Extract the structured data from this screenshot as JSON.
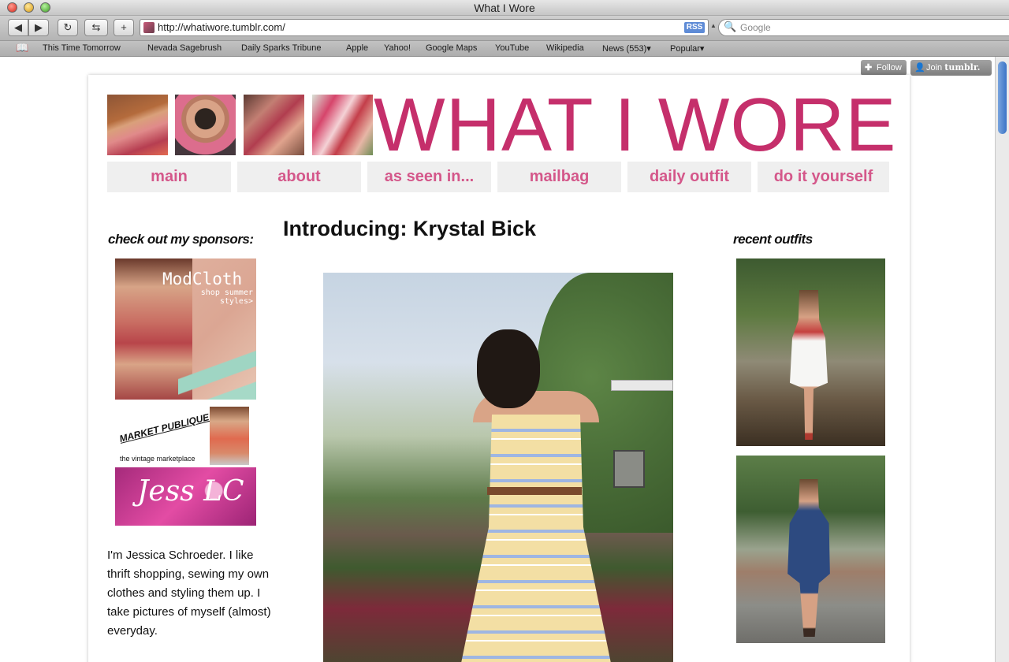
{
  "browser": {
    "window_title": "What I Wore",
    "url": "http://whatiwore.tumblr.com/",
    "rss_label": "RSS",
    "search_placeholder": "Google",
    "bookmarks": [
      "This Time Tomorrow",
      "Nevada Sagebrush",
      "Daily Sparks Tribune",
      "Apple",
      "Yahoo!",
      "Google Maps",
      "YouTube",
      "Wikipedia",
      "News (553)",
      "Popular"
    ]
  },
  "tumblr": {
    "follow_label": "Follow",
    "join_prefix": "Join",
    "join_brand": "tumblr."
  },
  "site": {
    "logo": "WHAT I WORE",
    "accent_color": "#c52f6b",
    "nav": [
      "main",
      "about",
      "as seen in...",
      "mailbag",
      "daily outfit",
      "do it yourself"
    ]
  },
  "sidebar": {
    "sponsors_heading": "check out my sponsors:",
    "sponsors": {
      "modcloth": {
        "brand": "ModCloth",
        "tagline": "shop summer styles>"
      },
      "market": {
        "brand": "MARKET PUBLIQUE",
        "tagline": "the vintage marketplace"
      },
      "jess": {
        "brand": "Jess LC"
      }
    },
    "bio": "I'm Jessica Schroeder. I like thrift shopping, sewing my own clothes and styling them up. I take pictures of myself (almost) everyday."
  },
  "post": {
    "title": "Introducing: Krystal Bick"
  },
  "recent": {
    "heading": "recent outfits"
  }
}
